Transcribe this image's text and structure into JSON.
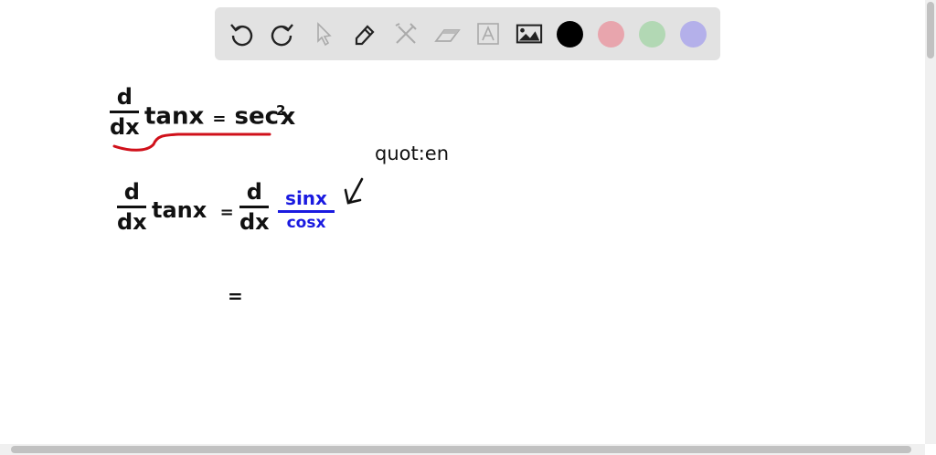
{
  "toolbar": {
    "tools": [
      "undo-icon",
      "redo-icon",
      "select-icon",
      "pen-icon",
      "tools-icon",
      "eraser-icon",
      "text-icon",
      "image-icon"
    ],
    "colors": [
      "#000000",
      "#e8a5ad",
      "#b2d8b4",
      "#b4b0ea"
    ]
  },
  "canvas": {
    "line1": {
      "d": "d",
      "dx": "dx",
      "lhs": "tanx",
      "eq": "=",
      "rhs": "sec",
      "exp": "2",
      "rhs_var": "x"
    },
    "annotation": "quot:en",
    "line2": {
      "d": "d",
      "dx": "dx",
      "lhs": "tanx",
      "eq": "=",
      "d2": "d",
      "dx2": "dx",
      "num": "sinx",
      "den": "cosx"
    },
    "line3": {
      "eq": "="
    },
    "ink_colors": {
      "black": "#111111",
      "red": "#d0101a",
      "blue": "#1a1ae0"
    }
  }
}
